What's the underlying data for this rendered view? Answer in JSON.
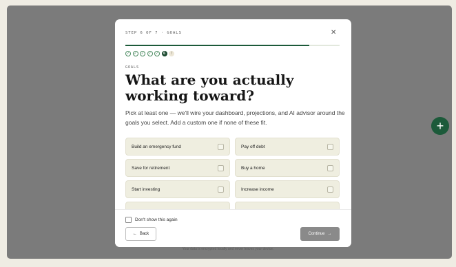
{
  "modal": {
    "step_label": "STEP 6 OF 7 · GOALS",
    "progress": 0.86,
    "steps": [
      {
        "label": "✓",
        "state": "done"
      },
      {
        "label": "✓",
        "state": "done"
      },
      {
        "label": "✓",
        "state": "done"
      },
      {
        "label": "✓",
        "state": "done"
      },
      {
        "label": "✓",
        "state": "done"
      },
      {
        "label": "6",
        "state": "current"
      },
      {
        "label": "7",
        "state": "todo"
      }
    ],
    "eyebrow": "GOALS",
    "title": "What are you actually working toward?",
    "subtitle": "Pick at least one — we'll wire your dashboard, projections, and AI advisor around the goals you select. Add a custom one if none of these fit.",
    "options": [
      "Build an emergency fund",
      "Pay off debt",
      "Save for retirement",
      "Buy a home",
      "Start investing",
      "Increase income"
    ],
    "dont_show": "Don't show this again",
    "back": "Back",
    "continue": "Continue"
  },
  "footnote": "Your data is encrypted locally and never leaves your device."
}
